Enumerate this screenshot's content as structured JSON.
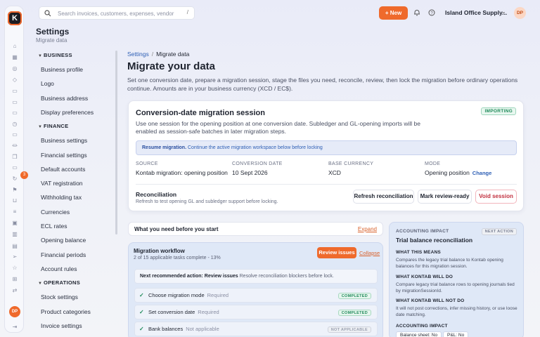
{
  "app": {
    "logo_letter": "K"
  },
  "rail": {
    "icons": [
      "home-icon",
      "calculator-icon",
      "globe-icon",
      "cube-icon",
      "document-icon",
      "document-icon",
      "document-icon",
      "clock-icon",
      "document-icon",
      "bank-icon",
      "copy-icon",
      "document-icon",
      "refresh-icon",
      "flag-icon",
      "cart-icon",
      "list-icon",
      "box-icon",
      "chart-icon",
      "book-icon",
      "send-icon",
      "star-icon",
      "grid-icon",
      "swap-icon"
    ],
    "badge": "3",
    "avatar": "DP",
    "logout_icon": "logout-icon"
  },
  "topbar": {
    "search_placeholder": "Search invoices, customers, expenses, vendor",
    "search_shortcut": "/",
    "new_button": "New",
    "org_name": "Island Office Supply...",
    "avatar": "DP"
  },
  "nav": {
    "title": "Settings",
    "subtitle": "Migrate data",
    "sections": [
      {
        "label": "BUSINESS",
        "items": [
          "Business profile",
          "Logo",
          "Business address",
          "Display preferences"
        ]
      },
      {
        "label": "FINANCE",
        "items": [
          "Business settings",
          "Financial settings",
          "Default accounts",
          "VAT registration",
          "Withholding tax",
          "Currencies",
          "ECL rates",
          "Opening balance",
          "Financial periods",
          "Account rules"
        ]
      },
      {
        "label": "OPERATIONS",
        "items": [
          "Stock settings",
          "Product categories",
          "Invoice settings"
        ]
      }
    ]
  },
  "main": {
    "breadcrumb": {
      "parent": "Settings",
      "current": "Migrate data"
    },
    "title": "Migrate your data",
    "description": "Set one conversion date, prepare a migration session, stage the files you need, reconcile, review, then lock the migration before ordinary operations continue. Amounts are in your business currency (XCD / EC$).",
    "session": {
      "title": "Conversion-date migration session",
      "status": "IMPORTING",
      "description": "Use one session for the opening position at one conversion date. Subledger and GL-opening imports will be enabled as session-safe batches in later migration steps.",
      "resume_bold": "Resume migration.",
      "resume_text": "Continue the active migration workspace below before locking",
      "fields": [
        {
          "label": "SOURCE",
          "value": "Kontab migration: opening position"
        },
        {
          "label": "CONVERSION DATE",
          "value": "10 Sept 2026"
        },
        {
          "label": "BASE CURRENCY",
          "value": "XCD"
        },
        {
          "label": "MODE",
          "value": "Opening position",
          "action": "Change"
        }
      ],
      "reconciliation_title": "Reconciliation",
      "reconciliation_desc": "Refresh to test opening GL and subledger support before locking.",
      "buttons": {
        "refresh": "Refresh reconciliation",
        "mark": "Mark review-ready",
        "void": "Void session"
      }
    },
    "need": {
      "title": "What you need before you start",
      "action": "Expand"
    },
    "workflow": {
      "title": "Migration workflow",
      "progress": "2 of 15 applicable tasks complete - 13%",
      "review_button": "Review issues",
      "collapse": "Collapse",
      "next_bold": "Next recommended action: Review issues",
      "next_text": "Resolve reconciliation blockers before lock.",
      "tasks": [
        {
          "name": "Choose migration mode",
          "req": "Required",
          "status": "COMPLETED"
        },
        {
          "name": "Set conversion date",
          "req": "Required",
          "status": "COMPLETED"
        },
        {
          "name": "Bank balances",
          "req": "Not applicable",
          "status": "NOT APPLICABLE"
        }
      ]
    }
  },
  "impact": {
    "label": "ACCOUNTING IMPACT",
    "badge": "NEXT ACTION",
    "title": "Trial balance reconciliation",
    "means_h": "WHAT THIS MEANS",
    "means": "Compares the legacy trial balance to Kontab opening balances for this migration session.",
    "will_h": "WHAT KONTAB WILL DO",
    "will": "Compare legacy trial balance rows to opening journals tied by migrationSessionId.",
    "wont_h": "WHAT KONTAB WILL NOT DO",
    "wont": "It will not post corrections, infer missing history, or use loose date matching.",
    "impact_h": "ACCOUNTING IMPACT",
    "chips": [
      "Balance sheet: No",
      "P&L: No"
    ]
  }
}
